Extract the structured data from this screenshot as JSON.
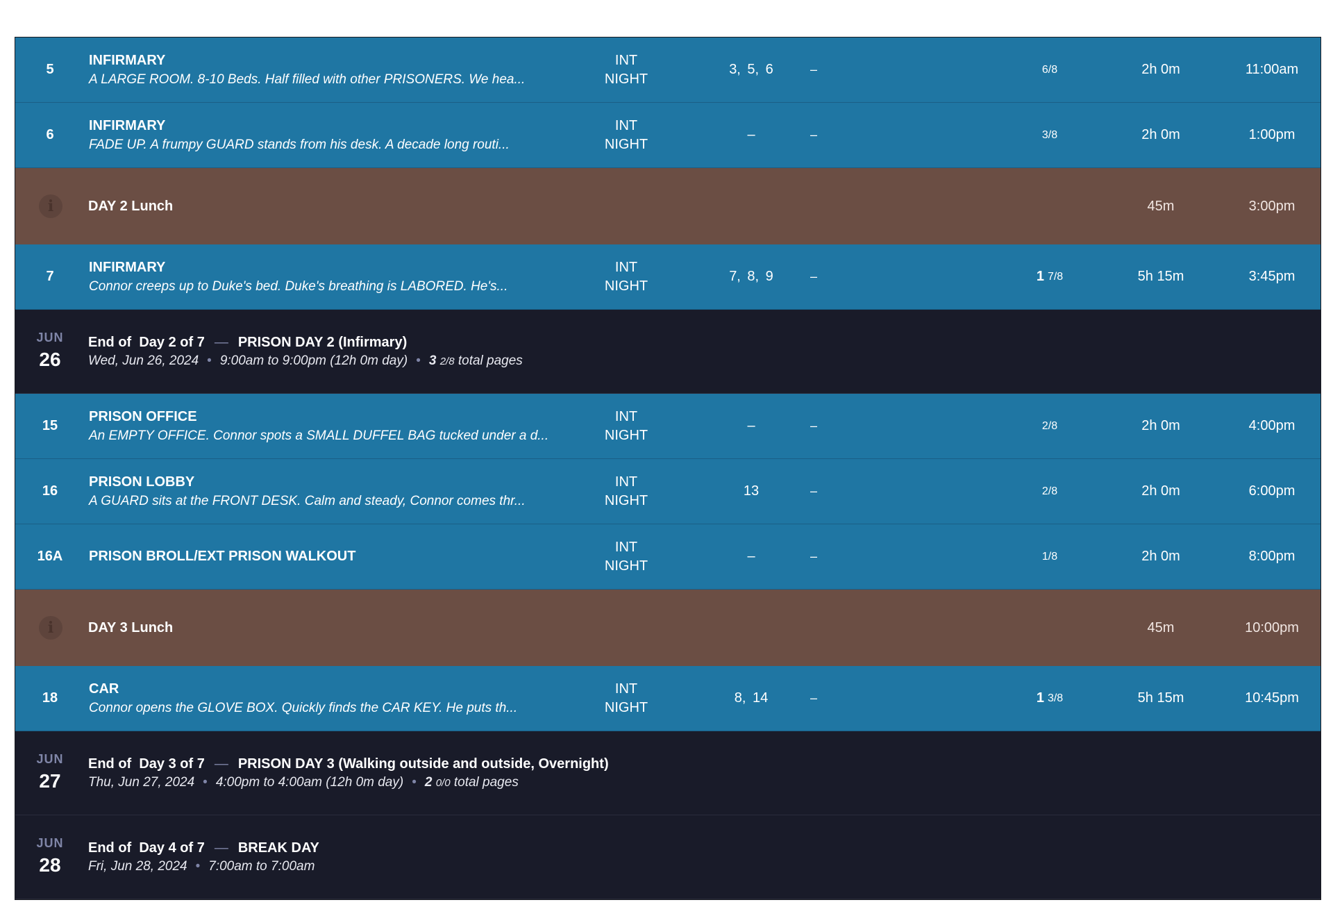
{
  "colors": {
    "scene_bg": "#1f76a3",
    "meal_bg": "#6b4e44",
    "dayend_bg": "#191b29",
    "muted_text": "#7f85a7"
  },
  "rows": [
    {
      "type": "scene",
      "scene": "5",
      "title": "INFIRMARY",
      "desc": "A LARGE ROOM. 8-10 Beds. Half filled with other PRISONERS. We hea...",
      "ie": "INT",
      "tod": "NIGHT",
      "cast": "3, 5, 6",
      "extra": "–",
      "pages_whole": "",
      "pages_frac": "6/8",
      "duration": "2h 0m",
      "time": "11:00am"
    },
    {
      "type": "scene",
      "scene": "6",
      "title": "INFIRMARY",
      "desc": "FADE UP. A frumpy GUARD stands from his desk. A decade long routi...",
      "ie": "INT",
      "tod": "NIGHT",
      "cast": "–",
      "extra": "–",
      "pages_whole": "",
      "pages_frac": "3/8",
      "duration": "2h 0m",
      "time": "1:00pm"
    },
    {
      "type": "meal",
      "icon": "info-icon",
      "icon_glyph": "i",
      "label": "DAY 2 Lunch",
      "duration": "45m",
      "time": "3:00pm"
    },
    {
      "type": "scene",
      "scene": "7",
      "title": "INFIRMARY",
      "desc": "Connor creeps up to Duke's bed. Duke's breathing is LABORED. He's...",
      "ie": "INT",
      "tod": "NIGHT",
      "cast": "7, 8, 9",
      "extra": "–",
      "pages_whole": "1",
      "pages_frac": "7/8",
      "duration": "5h 15m",
      "time": "3:45pm"
    },
    {
      "type": "dayend",
      "month": "JUN",
      "day": "26",
      "end_prefix": "End of",
      "day_label": "Day 2 of 7",
      "dash": "—",
      "day_name": "PRISON DAY 2 (Infirmary)",
      "date_text": "Wed, Jun 26, 2024",
      "hours": "9:00am to 9:00pm  (12h 0m day)",
      "dot": "•",
      "pages_whole": "3",
      "pages_frac": "2/8",
      "pages_suffix": "total pages"
    },
    {
      "type": "scene",
      "scene": "15",
      "title": "PRISON OFFICE",
      "desc": "An EMPTY OFFICE. Connor spots a SMALL DUFFEL BAG tucked under a d...",
      "ie": "INT",
      "tod": "NIGHT",
      "cast": "–",
      "extra": "–",
      "pages_whole": "",
      "pages_frac": "2/8",
      "duration": "2h 0m",
      "time": "4:00pm"
    },
    {
      "type": "scene",
      "scene": "16",
      "title": "PRISON LOBBY",
      "desc": "A GUARD sits at the FRONT DESK. Calm and steady, Connor comes thr...",
      "ie": "INT",
      "tod": "NIGHT",
      "cast": "13",
      "extra": "–",
      "pages_whole": "",
      "pages_frac": "2/8",
      "duration": "2h 0m",
      "time": "6:00pm"
    },
    {
      "type": "scene",
      "scene": "16A",
      "title": "PRISON BROLL/EXT PRISON WALKOUT",
      "desc": "",
      "ie": "INT",
      "tod": "NIGHT",
      "cast": "–",
      "extra": "–",
      "pages_whole": "",
      "pages_frac": "1/8",
      "duration": "2h 0m",
      "time": "8:00pm"
    },
    {
      "type": "meal",
      "icon": "info-icon",
      "icon_glyph": "i",
      "label": "DAY 3 Lunch",
      "duration": "45m",
      "time": "10:00pm"
    },
    {
      "type": "scene",
      "scene": "18",
      "title": "CAR",
      "desc": "Connor opens the GLOVE BOX. Quickly finds the CAR KEY. He puts th...",
      "ie": "INT",
      "tod": "NIGHT",
      "cast": "8, 14",
      "extra": "–",
      "pages_whole": "1",
      "pages_frac": "3/8",
      "duration": "5h 15m",
      "time": "10:45pm"
    },
    {
      "type": "dayend",
      "month": "JUN",
      "day": "27",
      "end_prefix": "End of",
      "day_label": "Day 3 of 7",
      "dash": "—",
      "day_name": "PRISON DAY 3 (Walking outside and outside, Overnight)",
      "date_text": "Thu, Jun 27, 2024",
      "hours": "4:00pm to 4:00am  (12h 0m day)",
      "dot": "•",
      "pages_whole": "2",
      "pages_frac": "0/0",
      "pages_suffix": "total pages"
    },
    {
      "type": "dayend",
      "month": "JUN",
      "day": "28",
      "end_prefix": "End of",
      "day_label": "Day 4 of 7",
      "dash": "—",
      "day_name": "BREAK DAY",
      "date_text": "Fri, Jun 28, 2024",
      "hours": "7:00am to 7:00am",
      "dot": "",
      "pages_whole": "",
      "pages_frac": "",
      "pages_suffix": ""
    }
  ]
}
